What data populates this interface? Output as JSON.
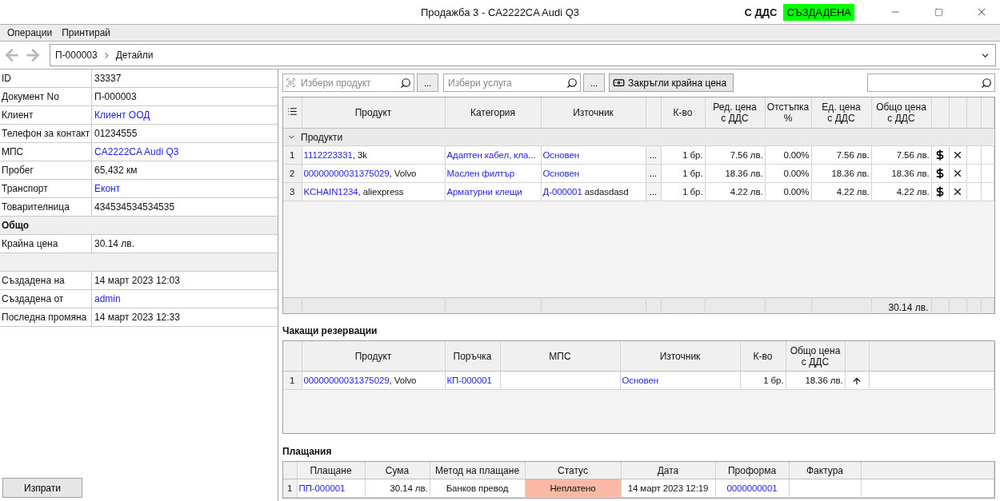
{
  "window": {
    "title": "Продажба 3 - CA2222CA Audi Q3",
    "vat_label": "С ДДС",
    "status": {
      "text": "СЪЗДАДЕНА",
      "color": "#00ff00"
    }
  },
  "menu": [
    "Операции",
    "Принтирай"
  ],
  "breadcrumb": [
    "П-000003",
    "Детайли"
  ],
  "details": [
    {
      "kind": "field",
      "label": "ID",
      "value": "33337",
      "link": false
    },
    {
      "kind": "field",
      "label": "Документ No",
      "value": "П-000003",
      "link": false
    },
    {
      "kind": "field",
      "label": "Клиент",
      "value": "Клиент ООД",
      "link": true
    },
    {
      "kind": "field",
      "label": "Телефон за контакт",
      "value": "01234555",
      "link": false
    },
    {
      "kind": "field",
      "label": "МПС",
      "value": "CA2222CA Audi Q3",
      "link": true
    },
    {
      "kind": "field",
      "label": "Пробег",
      "value": "65,432 км",
      "link": false
    },
    {
      "kind": "field",
      "label": "Транспорт",
      "value": "Еконт",
      "link": true
    },
    {
      "kind": "field",
      "label": "Товарителница",
      "value": "434534534534535",
      "link": false
    },
    {
      "kind": "section",
      "label": "Общо"
    },
    {
      "kind": "field",
      "label": "Крайна цена",
      "value": "30.14 лв.",
      "link": false
    },
    {
      "kind": "spacer"
    },
    {
      "kind": "field",
      "label": "Създадена на",
      "value": "14 март 2023 12:03",
      "link": false
    },
    {
      "kind": "field",
      "label": "Създадена от",
      "value": "admin",
      "link": true
    },
    {
      "kind": "field",
      "label": "Последна промяна",
      "value": "14 март 2023 12:33",
      "link": false
    }
  ],
  "send_button": "Изпрати",
  "toolbar": {
    "product_placeholder": "Избери продукт",
    "service_placeholder": "Избери услуга",
    "more": "...",
    "round_button": "Закръгли крайна цена"
  },
  "products": {
    "columns": [
      "Продукт",
      "Категория",
      "Източник",
      "К-во",
      "Ред. цена\nс ДДС",
      "Отстъпка\n%",
      "Ед. цена\nс ДДС",
      "Общо цена\nс ДДС"
    ],
    "group": "Продукти",
    "group_expanded": true,
    "rows": [
      {
        "num": "1",
        "code": "1112223331",
        "name": ", 3k",
        "category": "Адаптен кабел, кла...",
        "source": "Основен",
        "source_note": "",
        "more": "...",
        "qty": "1 бр.",
        "row_price": "7.56 лв.",
        "discount": "0.00%",
        "unit_price": "7.56 лв.",
        "total": "7.56 лв."
      },
      {
        "num": "2",
        "code": "00000000031375029",
        "name": ", Volvo",
        "category": "Маслен филтър",
        "source": "Основен",
        "source_note": "",
        "more": "...",
        "qty": "1 бр.",
        "row_price": "18.36 лв.",
        "discount": "0.00%",
        "unit_price": "18.36 лв.",
        "total": "18.36 лв."
      },
      {
        "num": "3",
        "code": "KCHAIN1234",
        "name": ", aliexpress",
        "category": "Арматурни клещи",
        "source": "Д-000001",
        "source_note": "asdasdasd",
        "more": "...",
        "qty": "1 бр.",
        "row_price": "4.22 лв.",
        "discount": "0.00%",
        "unit_price": "4.22 лв.",
        "total": "4.22 лв."
      }
    ],
    "footer_total": "30.14 лв."
  },
  "reservations": {
    "title": "Чакащи резервации",
    "columns": [
      "Продукт",
      "Поръчка",
      "МПС",
      "Източник",
      "К-во",
      "Общо цена\nс ДДС"
    ],
    "rows": [
      {
        "num": "1",
        "code": "00000000031375029",
        "name": ", Volvo",
        "order": "КП-000001",
        "source": "Основен",
        "qty": "1 бр.",
        "total": "18.36 лв."
      }
    ]
  },
  "payments": {
    "title": "Плащания",
    "columns": [
      "Плащане",
      "Сума",
      "Метод на плащане",
      "Статус",
      "Дата",
      "Проформа",
      "Фактура"
    ],
    "rows": [
      {
        "num": "1",
        "payment": "ПП-000001",
        "amount": "30.14 лв.",
        "method": "Банков превод",
        "status": "Неплатено",
        "color": "#fbb8a4",
        "date": "14 март 2023 12:19",
        "proforma": "0000000001"
      }
    ]
  }
}
